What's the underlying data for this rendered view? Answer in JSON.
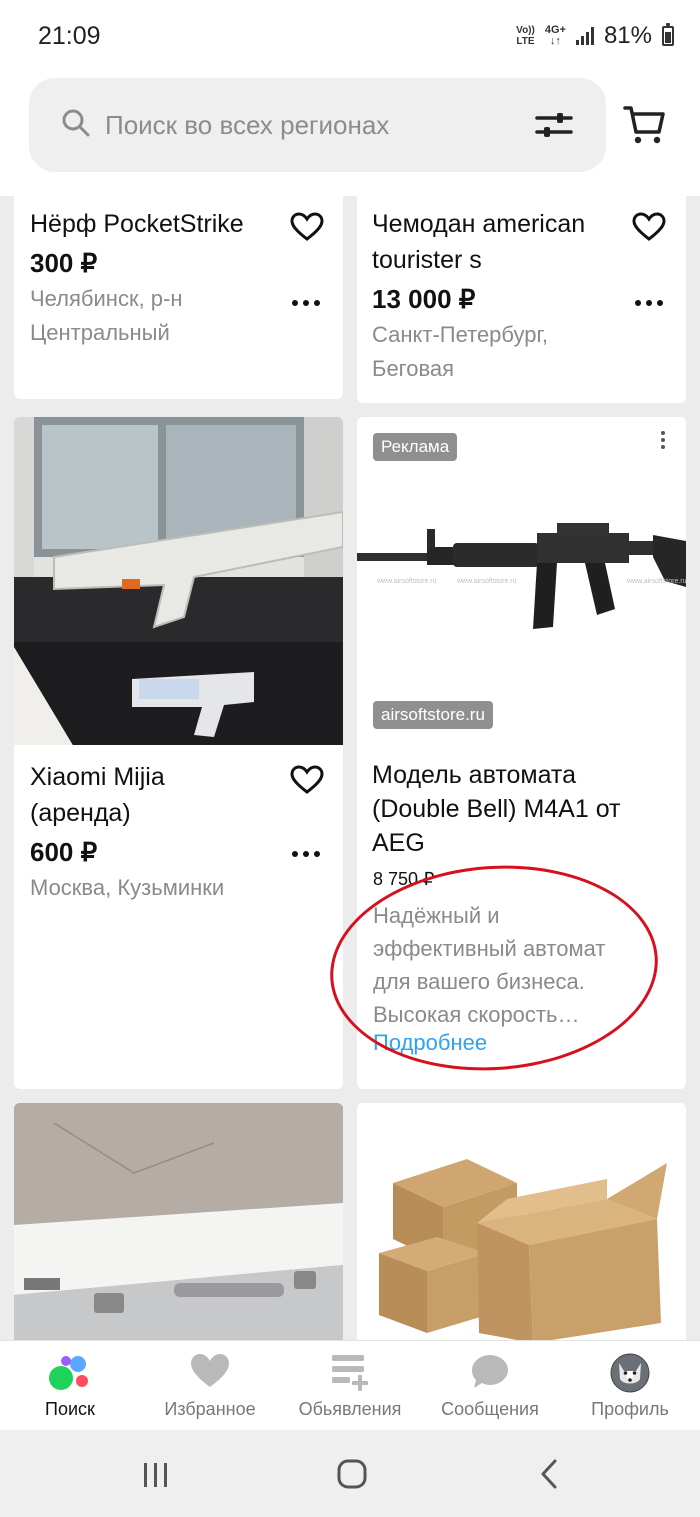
{
  "status_bar": {
    "time": "21:09",
    "volte": "Vo)) LTE",
    "network": "4G+",
    "battery": "81%",
    "battery_level": 0.81
  },
  "search": {
    "placeholder": "Поиск во всех регионах",
    "icon": "search-icon",
    "filter_icon": "sliders-icon",
    "cart_icon": "cart-icon"
  },
  "listings": [
    {
      "title": "Нёрф PocketStrike",
      "price": "300 ₽",
      "location_1": "Челябинск, р-н",
      "location_2": "Центральный"
    },
    {
      "title_1": "Чемодан american",
      "title_2": "tourister s",
      "price": "13 000 ₽",
      "location_1": "Санкт-Петербург,",
      "location_2": "Беговая"
    },
    {
      "title_1": "Xiaomi Mijia",
      "title_2": "(аренда)",
      "price": "600 ₽",
      "location": "Москва, Кузьминки"
    }
  ],
  "ad": {
    "badge": "Реклама",
    "source": "airsoftstore.ru",
    "title_1": "Модель автомата",
    "title_2": "(Double Bell) M4A1 от",
    "title_3": "AEG",
    "price": "8 750 ₽",
    "desc_1": "Надёжный и",
    "desc_2": "эффективный автомат",
    "desc_3": "для вашего бизнеса.",
    "desc_4": "Высокая скорость…",
    "more_link": "Подробнее"
  },
  "bottom_nav": [
    {
      "label": "Поиск",
      "icon": "search-dots-icon",
      "active": true
    },
    {
      "label": "Избранное",
      "icon": "heart-icon",
      "active": false
    },
    {
      "label": "Обьявления",
      "icon": "ad-list-icon",
      "active": false
    },
    {
      "label": "Сообщения",
      "icon": "chat-icon",
      "active": false
    },
    {
      "label": "Профиль",
      "icon": "avatar-icon",
      "active": false
    }
  ],
  "colors": {
    "accent_link": "#2ea3f2",
    "annotation": "#d6101e",
    "badge_bg": "#8f8f8f"
  }
}
